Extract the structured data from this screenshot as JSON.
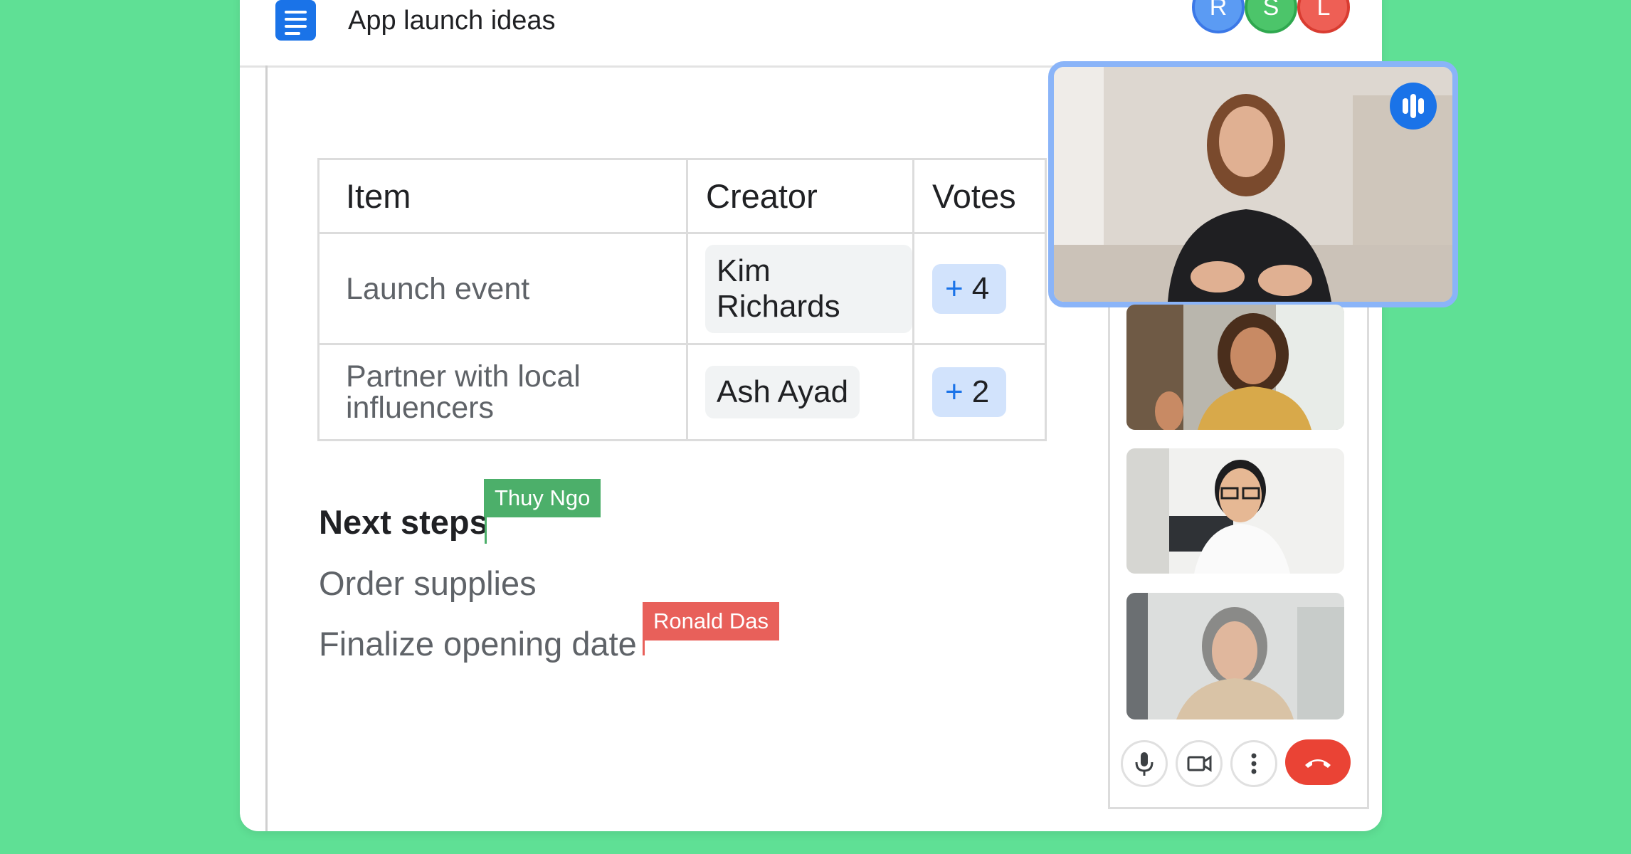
{
  "doc": {
    "title": "App launch ideas",
    "icon": "google-docs-icon"
  },
  "collaborators": [
    {
      "initial": "R",
      "color": "#4285f4"
    },
    {
      "initial": "S",
      "color": "#34a853"
    },
    {
      "initial": "L",
      "color": "#ea4335"
    }
  ],
  "table": {
    "headers": [
      "Item",
      "Creator",
      "Votes"
    ],
    "rows": [
      {
        "item": "Launch event",
        "creator": "Kim Richards",
        "votes_plus": "+",
        "votes": "4"
      },
      {
        "item_line1": "Partner with local",
        "item_line2": "influencers",
        "creator": "Ash Ayad",
        "votes_plus": "+",
        "votes": "2"
      }
    ]
  },
  "next_steps": {
    "heading": "Next steps",
    "items": [
      "Order supplies",
      "Finalize opening date"
    ]
  },
  "cursors": [
    {
      "name": "Thuy Ngo",
      "color": "#4caf6a"
    },
    {
      "name": "Ronald Das",
      "color": "#e8605a"
    }
  ],
  "meet": {
    "participants": [
      "presenter-video",
      "participant-video-2",
      "participant-video-3",
      "participant-video-4"
    ],
    "controls": [
      "microphone-icon",
      "camera-icon",
      "more-options-icon",
      "end-call-icon"
    ],
    "end_call_color": "#ea4335"
  }
}
